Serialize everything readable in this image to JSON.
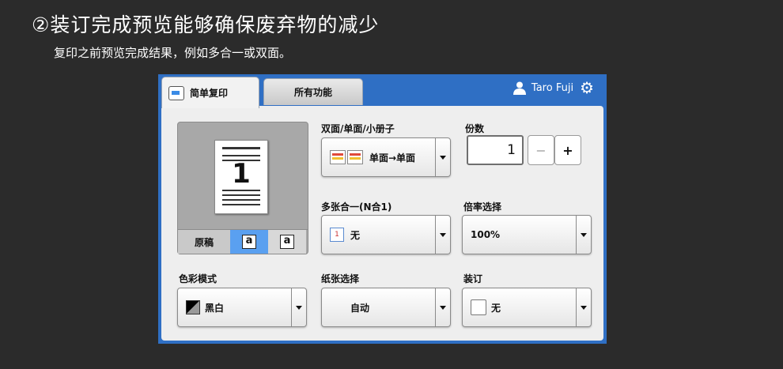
{
  "hero": {
    "title": "②装订完成预览能够确保废弃物的减少",
    "subtitle": "复印之前预览完成结果，例如多合一或双面。"
  },
  "tabs": [
    {
      "label": "简单复印",
      "active": true
    },
    {
      "label": "所有功能",
      "active": false
    }
  ],
  "user": {
    "name": "Taro Fuji"
  },
  "preview": {
    "page_number": "1",
    "original_label": "原稿",
    "orientation_options": [
      "a",
      "a"
    ],
    "selected_orientation": 0
  },
  "duplex": {
    "label": "双面/单面/小册子",
    "value": "单面→单面"
  },
  "copies": {
    "label": "份数",
    "value": "1",
    "minus": "−",
    "plus": "+"
  },
  "nup": {
    "label": "多张合一(N合1)",
    "value": "无",
    "icon_text": "1"
  },
  "zoom": {
    "label": "倍率选择",
    "value": "100%"
  },
  "color_mode": {
    "label": "色彩模式",
    "value": "黑白"
  },
  "paper": {
    "label": "纸张选择",
    "value": "自动"
  },
  "staple": {
    "label": "装订",
    "value": "无"
  },
  "colors": {
    "panel_blue": "#2f6fc4",
    "background": "#2b2b2b",
    "selected_blue": "#5aa0f0"
  }
}
